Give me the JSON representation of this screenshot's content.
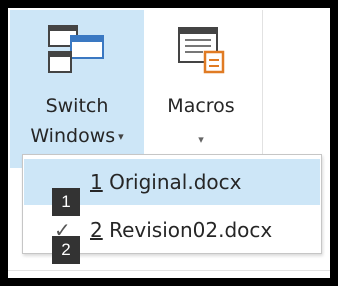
{
  "ribbon": {
    "switch_windows": {
      "label_line1": "Switch",
      "label_line2": "Windows",
      "icon": "switch-windows-icon",
      "selected_color": "#cde6f7"
    },
    "macros": {
      "label": "Macros",
      "icon": "macros-icon"
    }
  },
  "menu": {
    "items": [
      {
        "number": "1",
        "name": " Original.docx",
        "selected": true,
        "keytip": "1"
      },
      {
        "number": "2",
        "name": " Revision02.docx",
        "selected": false,
        "checked": true,
        "keytip": "2"
      }
    ]
  },
  "colors": {
    "highlight": "#cde6f7",
    "keytip_bg": "#333333",
    "icon_accent": "#e07b24"
  }
}
